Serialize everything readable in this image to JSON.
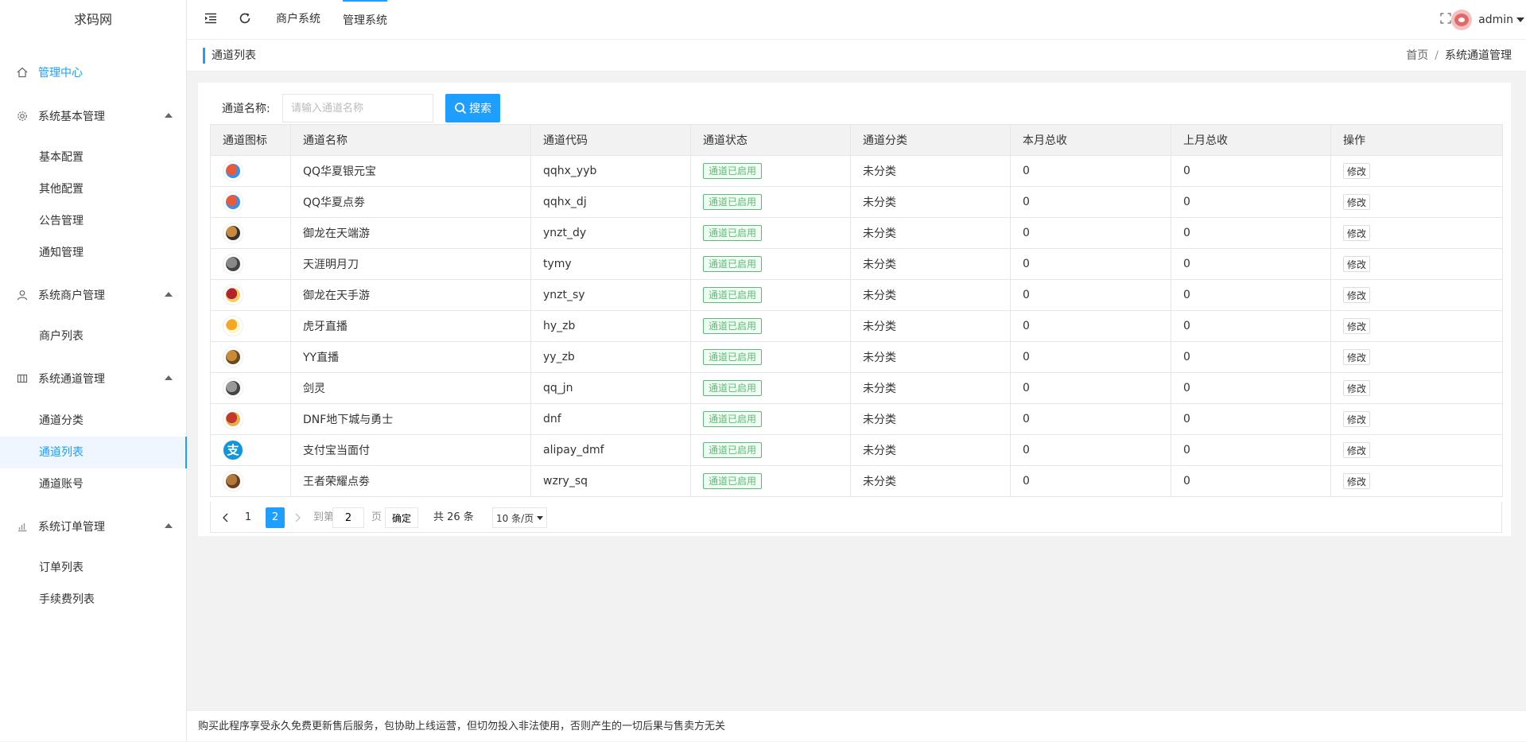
{
  "app": {
    "title": "求码网"
  },
  "sidebar": {
    "groups": [
      {
        "label": "管理中心",
        "icon": "home-icon"
      },
      {
        "label": "系统基本管理",
        "icon": "gear-icon",
        "items": [
          "基本配置",
          "其他配置",
          "公告管理",
          "通知管理"
        ]
      },
      {
        "label": "系统商户管理",
        "icon": "user-icon",
        "items": [
          "商户列表"
        ]
      },
      {
        "label": "系统通道管理",
        "icon": "grid-icon",
        "items": [
          "通道分类",
          "通道列表",
          "通道账号"
        ]
      },
      {
        "label": "系统订单管理",
        "icon": "chart-icon",
        "items": [
          "订单列表",
          "手续费列表"
        ]
      }
    ],
    "selected": "通道列表"
  },
  "header": {
    "tabs": [
      "商户系统",
      "管理系统"
    ],
    "active_tab": "管理系统",
    "user": "admin"
  },
  "breadcrumb": {
    "title": "通道列表",
    "home": "首页",
    "sep": "/",
    "current": "系统通道管理"
  },
  "search": {
    "label": "通道名称:",
    "placeholder": "请输入通道名称",
    "button": "搜索"
  },
  "table": {
    "columns": [
      "通道图标",
      "通道名称",
      "通道代码",
      "通道状态",
      "通道分类",
      "本月总收",
      "上月总收",
      "操作"
    ],
    "rows": [
      {
        "icon": "qq-huaxia-icon",
        "name": "QQ华夏银元宝",
        "code": "qqhx_yyb",
        "status": "通道已启用",
        "category": "未分类",
        "this_month": "0",
        "last_month": "0",
        "action": "修改"
      },
      {
        "icon": "qq-huaxia-icon",
        "name": "QQ华夏点劵",
        "code": "qqhx_dj",
        "status": "通道已启用",
        "category": "未分类",
        "this_month": "0",
        "last_month": "0",
        "action": "修改"
      },
      {
        "icon": "yulong-icon",
        "name": "御龙在天端游",
        "code": "ynzt_dy",
        "status": "通道已启用",
        "category": "未分类",
        "this_month": "0",
        "last_month": "0",
        "action": "修改"
      },
      {
        "icon": "tianya-icon",
        "name": "天涯明月刀",
        "code": "tymy",
        "status": "通道已启用",
        "category": "未分类",
        "this_month": "0",
        "last_month": "0",
        "action": "修改"
      },
      {
        "icon": "yulong-mobile-icon",
        "name": "御龙在天手游",
        "code": "ynzt_sy",
        "status": "通道已启用",
        "category": "未分类",
        "this_month": "0",
        "last_month": "0",
        "action": "修改"
      },
      {
        "icon": "huya-icon",
        "name": "虎牙直播",
        "code": "hy_zb",
        "status": "通道已启用",
        "category": "未分类",
        "this_month": "0",
        "last_month": "0",
        "action": "修改"
      },
      {
        "icon": "yy-icon",
        "name": "YY直播",
        "code": "yy_zb",
        "status": "通道已启用",
        "category": "未分类",
        "this_month": "0",
        "last_month": "0",
        "action": "修改"
      },
      {
        "icon": "jianling-icon",
        "name": "剑灵",
        "code": "qq_jn",
        "status": "通道已启用",
        "category": "未分类",
        "this_month": "0",
        "last_month": "0",
        "action": "修改"
      },
      {
        "icon": "dnf-icon",
        "name": "DNF地下城与勇士",
        "code": "dnf",
        "status": "通道已启用",
        "category": "未分类",
        "this_month": "0",
        "last_month": "0",
        "action": "修改"
      },
      {
        "icon": "alipay-icon",
        "name": "支付宝当面付",
        "code": "alipay_dmf",
        "status": "通道已启用",
        "category": "未分类",
        "this_month": "0",
        "last_month": "0",
        "action": "修改"
      },
      {
        "icon": "wzry-icon",
        "name": "王者荣耀点劵",
        "code": "wzry_sq",
        "status": "通道已启用",
        "category": "未分类",
        "this_month": "0",
        "last_month": "0",
        "action": "修改"
      }
    ]
  },
  "pagination": {
    "pages": [
      "1",
      "2"
    ],
    "current": "2",
    "goto_label": "到第",
    "goto_value": "2",
    "page_suffix": "页",
    "ok": "确定",
    "total": "共 26 条",
    "per_page": "10 条/页"
  },
  "footer": {
    "text": "购买此程序享受永久免费更新售后服务，包协助上线运营，但切勿投入非法使用，否则产生的一切后果与售卖方无关"
  },
  "colors": {
    "accent": "#1e9fff",
    "success": "#5fb878"
  }
}
